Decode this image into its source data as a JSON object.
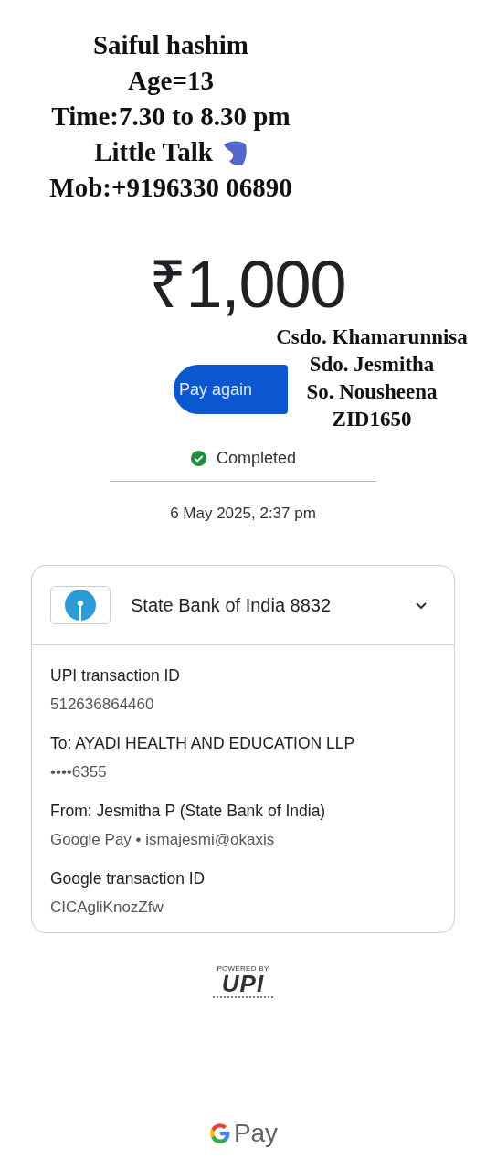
{
  "note_top": [
    {
      "text": "Saiful hashim",
      "sticker": false
    },
    {
      "text": "Age=13",
      "sticker": false
    },
    {
      "text": "Time:7.30 to 8.30 pm",
      "sticker": false
    },
    {
      "text": "Little Talk",
      "sticker": true
    },
    {
      "text": "Mob:+9196330 06890",
      "sticker": false
    }
  ],
  "note_right": [
    "Csdo. Khamarunnisa",
    "Sdo. Jesmitha",
    "So. Nousheena",
    "ZID1650"
  ],
  "amount": "₹1,000",
  "pay_again_button": "Pay again",
  "status": {
    "kind": "completed",
    "label": "Completed"
  },
  "date": "6 May 2025, 2:37 pm",
  "account": {
    "name": "State Bank of India 8832",
    "expanded": false
  },
  "details": [
    {
      "label": "UPI transaction ID",
      "value": "512636864460"
    },
    {
      "label": "To: AYADI HEALTH AND EDUCATION LLP",
      "value": "••••6355"
    },
    {
      "label": "From: Jesmitha  P (State Bank of India)",
      "value": "Google Pay • ismajesmi@okaxis"
    },
    {
      "label": "Google transaction ID",
      "value": "CICAgliKnozZfw"
    }
  ],
  "footer": {
    "powered_by": "POWERED BY",
    "upi_logo": "UPI",
    "brand": "Pay"
  }
}
